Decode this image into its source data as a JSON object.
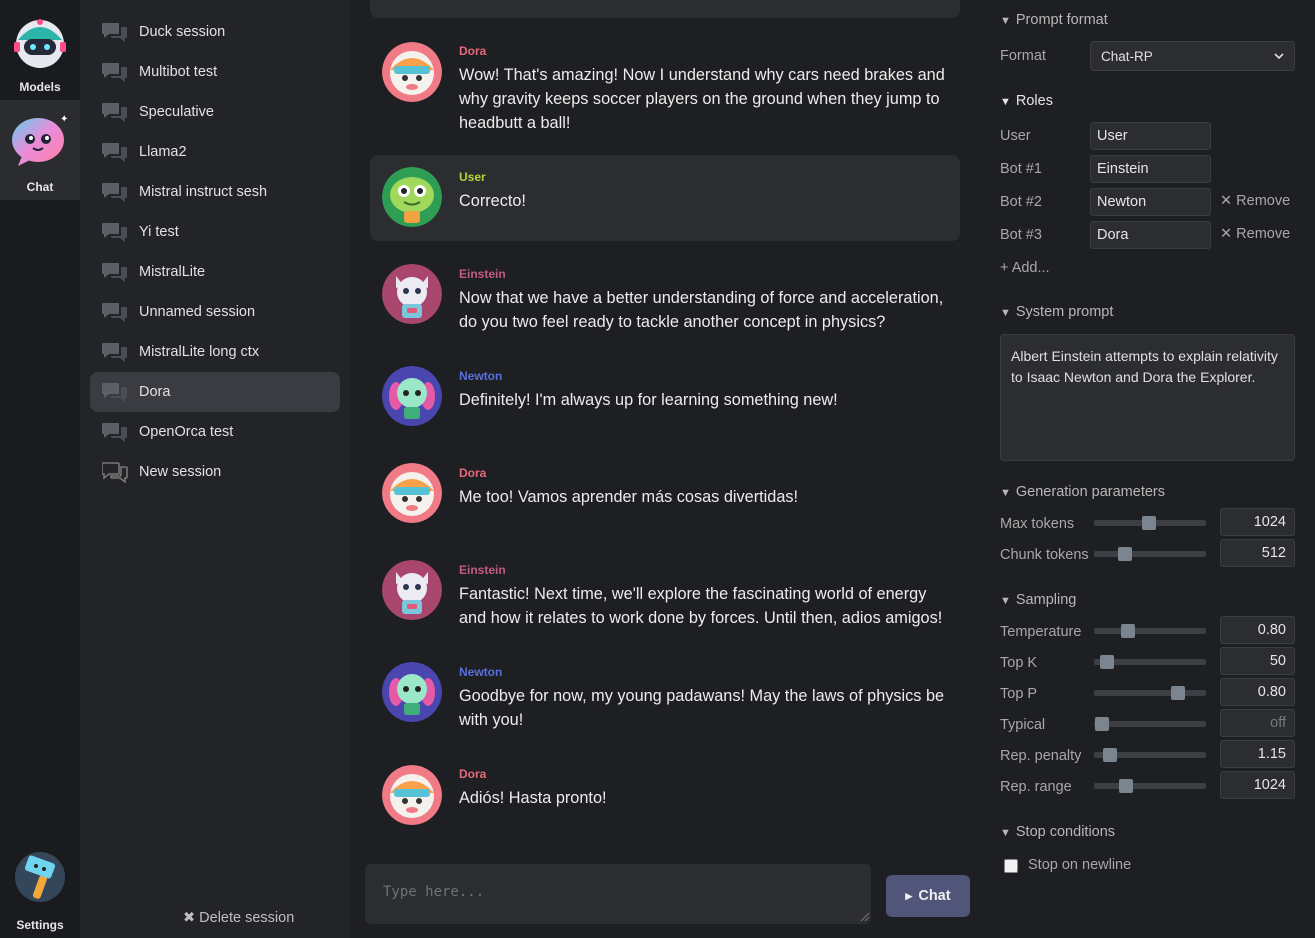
{
  "nav": {
    "models_label": "Models",
    "chat_label": "Chat",
    "settings_label": "Settings"
  },
  "sessions": {
    "items": [
      {
        "label": "Duck session"
      },
      {
        "label": "Multibot test"
      },
      {
        "label": "Speculative"
      },
      {
        "label": "Llama2"
      },
      {
        "label": "Mistral instruct sesh"
      },
      {
        "label": "Yi test"
      },
      {
        "label": "MistralLite"
      },
      {
        "label": "Unnamed session"
      },
      {
        "label": "MistralLite long ctx"
      },
      {
        "label": "Dora",
        "active": true
      },
      {
        "label": "OpenOrca test"
      },
      {
        "label": "New session"
      }
    ],
    "delete_label": "✖ Delete session"
  },
  "chat": {
    "messages": [
      {
        "author": "Dora",
        "text": "Wow! That's amazing! Now I understand why cars need brakes and why gravity keeps soccer players on the ground when they jump to headbutt a ball!"
      },
      {
        "author": "User",
        "text": "Correcto!"
      },
      {
        "author": "Einstein",
        "text": "Now that we have a better understanding of force and acceleration, do you two feel ready to tackle another concept in physics?"
      },
      {
        "author": "Newton",
        "text": "Definitely! I'm always up for learning something new!"
      },
      {
        "author": "Dora",
        "text": "Me too! Vamos aprender más cosas divertidas!"
      },
      {
        "author": "Einstein",
        "text": "Fantastic! Next time, we'll explore the fascinating world of energy and how it relates to work done by forces. Until then, adios amigos!"
      },
      {
        "author": "Newton",
        "text": "Goodbye for now, my young padawans! May the laws of physics be with you!"
      },
      {
        "author": "Dora",
        "text": "Adiós! Hasta pronto!"
      }
    ],
    "input_placeholder": "Type here...",
    "send_label": "Chat"
  },
  "colors": {
    "dora": "#e86a7a",
    "user": "#b8d33a",
    "einstein": "#c25a86",
    "newton": "#5a6ed8",
    "accent_button": "#51557a"
  },
  "panel": {
    "prompt_format": {
      "heading": "Prompt format",
      "format_label": "Format",
      "format_value": "Chat-RP"
    },
    "roles": {
      "heading": "Roles",
      "user_label": "User",
      "user_value": "User",
      "bot1_label": "Bot #1",
      "bot1_value": "Einstein",
      "bot2_label": "Bot #2",
      "bot2_value": "Newton",
      "bot3_label": "Bot #3",
      "bot3_value": "Dora",
      "remove_label": "✕ Remove",
      "add_label": "+ Add..."
    },
    "system_prompt": {
      "heading": "System prompt",
      "text": "Albert Einstein attempts to explain relativity to Isaac Newton and Dora the Explorer."
    },
    "generation": {
      "heading": "Generation parameters",
      "max_tokens_label": "Max tokens",
      "max_tokens_value": "1024",
      "max_tokens_level": 0.49,
      "chunk_tokens_label": "Chunk tokens",
      "chunk_tokens_value": "512",
      "chunk_tokens_level": 0.28
    },
    "sampling": {
      "heading": "Sampling",
      "temperature_label": "Temperature",
      "temperature_value": "0.80",
      "temperature_level": 0.3,
      "topk_label": "Top K",
      "topk_value": "50",
      "topk_level": 0.12,
      "topp_label": "Top P",
      "topp_value": "0.80",
      "topp_level": 0.75,
      "typical_label": "Typical",
      "typical_value": "off",
      "typical_level": 0.07,
      "rep_penalty_label": "Rep. penalty",
      "rep_penalty_value": "1.15",
      "rep_penalty_level": 0.14,
      "rep_range_label": "Rep. range",
      "rep_range_value": "1024",
      "rep_range_level": 0.29
    },
    "stop": {
      "heading": "Stop conditions",
      "stop_newline_label": "Stop on newline",
      "stop_newline_checked": false
    }
  }
}
